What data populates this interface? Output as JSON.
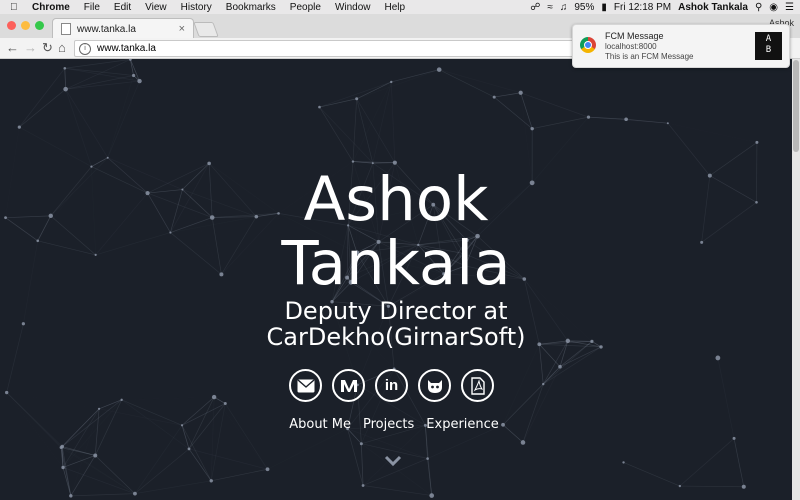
{
  "menubar": {
    "app": "Chrome",
    "items": [
      "File",
      "Edit",
      "View",
      "History",
      "Bookmarks",
      "People",
      "Window",
      "Help"
    ],
    "battery": "95%",
    "clock": "Fri 12:18 PM",
    "user": "Ashok Tankala"
  },
  "browser": {
    "tab_title": "www.tanka.la",
    "url": "www.tanka.la",
    "profile": "Ashok"
  },
  "page": {
    "name_line1": "Ashok",
    "name_line2": "Tankala",
    "role_line1": "Deputy Director at",
    "role_line2": "CarDekho(GirnarSoft)",
    "social_icons": [
      "mail-icon",
      "medium-icon",
      "linkedin-icon",
      "github-icon",
      "pdf-icon"
    ],
    "links": [
      "About Me",
      "Projects",
      "Experience"
    ]
  },
  "notification": {
    "title": "FCM Message",
    "origin": "localhost:8000",
    "body": "This is an FCM Message",
    "badge_line1": "A",
    "badge_line2": "B"
  },
  "colors": {
    "background": "#1b2029",
    "text": "#ffffff",
    "network": "#8a93a3"
  }
}
